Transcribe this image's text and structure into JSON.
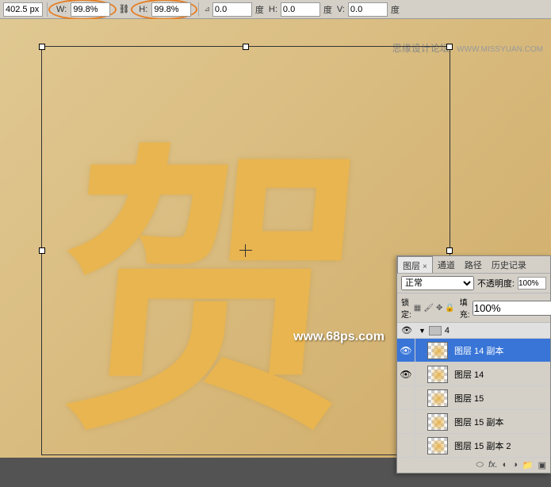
{
  "toolbar": {
    "pos_value": "402.5 px",
    "w_label": "W:",
    "w_value": "99.8%",
    "h_label": "H:",
    "h_value": "99.8%",
    "angle_value": "0.0",
    "angle_unit": "度",
    "skew_h_label": "H:",
    "skew_h_value": "0.0",
    "skew_v_label": "V:",
    "skew_v_value": "0.0"
  },
  "watermarks": {
    "top_text": "思缘设计论坛",
    "top_site": "WWW.MISSYUAN.COM",
    "mid_text": "www.68ps.com"
  },
  "layers_panel": {
    "tabs": {
      "layers": "图层",
      "channels": "通道",
      "paths": "路径",
      "history": "历史记录"
    },
    "blend_mode": "正常",
    "opacity_label": "不透明度:",
    "opacity_value": "100%",
    "lock_label": "锁定:",
    "fill_label": "填充:",
    "fill_value": "100%",
    "group_name": "4",
    "layers": [
      {
        "name": "图层 14 副本",
        "visible": true,
        "selected": true
      },
      {
        "name": "图层 14",
        "visible": true,
        "selected": false
      },
      {
        "name": "图层 15",
        "visible": false,
        "selected": false
      },
      {
        "name": "图层 15 副本",
        "visible": false,
        "selected": false
      },
      {
        "name": "图层 15 副本 2",
        "visible": false,
        "selected": false
      }
    ]
  },
  "canvas_glyph": "贺"
}
